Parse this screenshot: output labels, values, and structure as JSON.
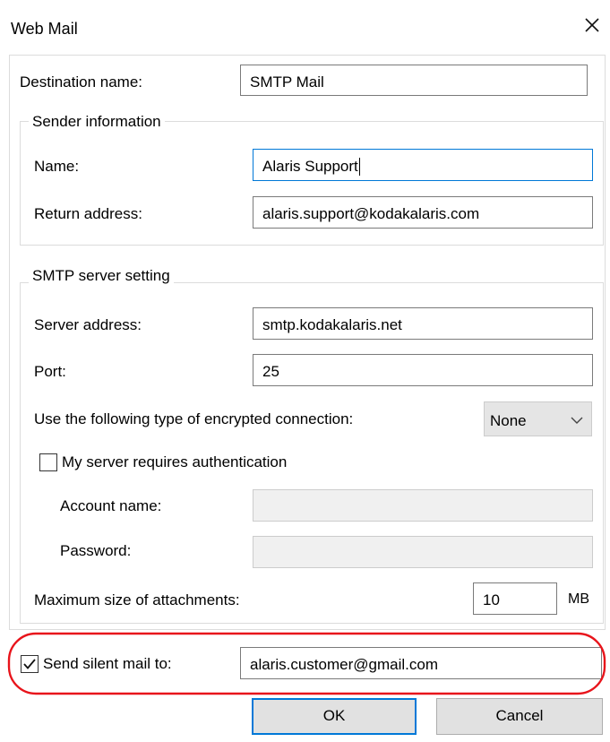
{
  "dialog": {
    "title": "Web Mail"
  },
  "destination": {
    "label": "Destination name:",
    "value": "SMTP Mail"
  },
  "sender": {
    "legend": "Sender information",
    "name_label": "Name:",
    "name_value": "Alaris Support",
    "return_label": "Return address:",
    "return_value": "alaris.support@kodakalaris.com"
  },
  "smtp": {
    "legend": "SMTP server setting",
    "server_label": "Server address:",
    "server_value": "smtp.kodakalaris.net",
    "port_label": "Port:",
    "port_value": "25",
    "encryption_label": "Use the following type of encrypted connection:",
    "encryption_value": "None",
    "auth_label": "My server requires authentication",
    "auth_checked": false,
    "account_label": "Account name:",
    "account_value": "",
    "password_label": "Password:",
    "password_value": "",
    "maxsize_label": "Maximum size of attachments:",
    "maxsize_value": "10",
    "maxsize_unit": "MB"
  },
  "silent": {
    "label": "Send silent mail to:",
    "checked": true,
    "value": "alaris.customer@gmail.com"
  },
  "buttons": {
    "ok": "OK",
    "cancel": "Cancel"
  },
  "colors": {
    "highlight": "#e8141b",
    "focus_border": "#0078d7"
  }
}
